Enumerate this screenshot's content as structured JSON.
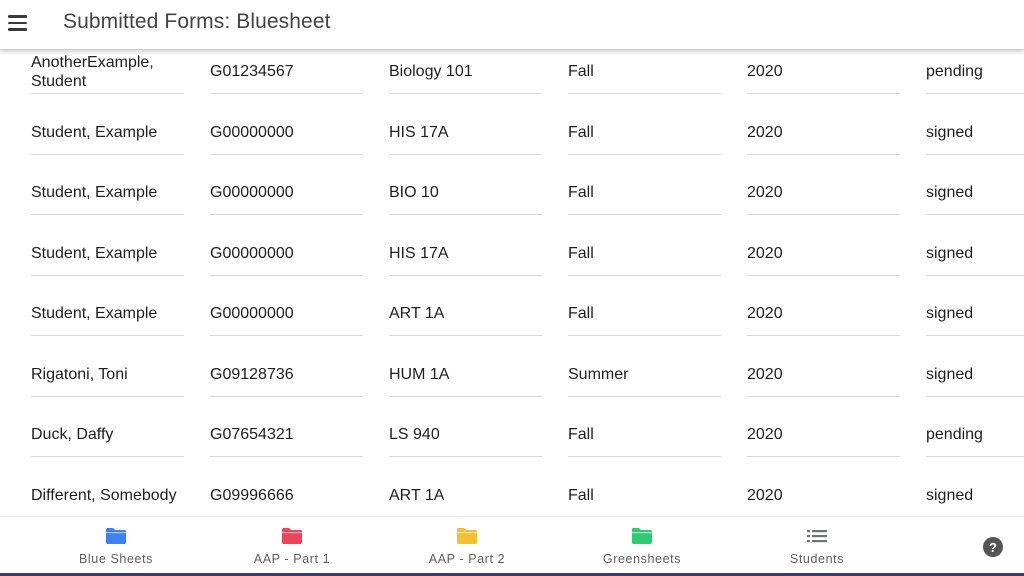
{
  "header": {
    "title": "Submitted Forms: Bluesheet",
    "menu_icon": "hamburger-menu-icon"
  },
  "rows": [
    [
      "AnotherExample, Student",
      "G01234567",
      "Biology 101",
      "Fall",
      "2020",
      "pending"
    ],
    [
      "Student, Example",
      "G00000000",
      "HIS 17A",
      "Fall",
      "2020",
      "signed"
    ],
    [
      "Student, Example",
      "G00000000",
      "BIO 10",
      "Fall",
      "2020",
      "signed"
    ],
    [
      "Student, Example",
      "G00000000",
      "HIS 17A",
      "Fall",
      "2020",
      "signed"
    ],
    [
      "Student, Example",
      "G00000000",
      "ART 1A",
      "Fall",
      "2020",
      "signed"
    ],
    [
      "Rigatoni, Toni",
      "G09128736",
      "HUM 1A",
      "Summer",
      "2020",
      "signed"
    ],
    [
      "Duck, Daffy",
      "G07654321",
      "LS 940",
      "Fall",
      "2020",
      "pending"
    ],
    [
      "Different, Somebody",
      "G09996666",
      "ART 1A",
      "Fall",
      "2020",
      "signed"
    ]
  ],
  "bottom_nav": {
    "items": [
      {
        "label": "Blue Sheets",
        "icon": "folder-icon",
        "color": "#3b82f6"
      },
      {
        "label": "AAP - Part 1",
        "icon": "folder-icon",
        "color": "#ef4458"
      },
      {
        "label": "AAP - Part 2",
        "icon": "folder-icon",
        "color": "#f5c02c"
      },
      {
        "label": "Greensheets",
        "icon": "folder-icon",
        "color": "#2ecc71"
      },
      {
        "label": "Students",
        "icon": "list-icon",
        "color": "#6b7280"
      }
    ],
    "help": "?"
  }
}
